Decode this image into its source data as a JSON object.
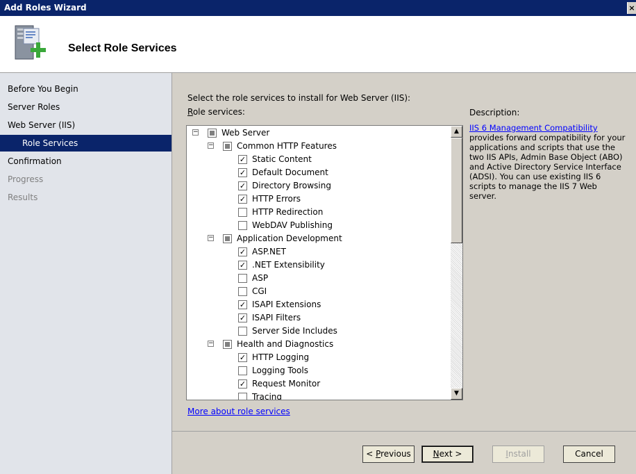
{
  "window": {
    "title": "Add Roles Wizard",
    "close_glyph": "×"
  },
  "header": {
    "title": "Select Role Services",
    "icon": "server-add-icon"
  },
  "nav": [
    {
      "label": "Before You Begin",
      "state": "normal"
    },
    {
      "label": "Server Roles",
      "state": "normal"
    },
    {
      "label": "Web Server (IIS)",
      "state": "normal"
    },
    {
      "label": "Role Services",
      "state": "active"
    },
    {
      "label": "Confirmation",
      "state": "normal"
    },
    {
      "label": "Progress",
      "state": "disabled"
    },
    {
      "label": "Results",
      "state": "disabled"
    }
  ],
  "content": {
    "prompt": "Select the role services to install for Web Server (IIS):",
    "role_services_label_prefix": "R",
    "role_services_label_rest": "ole services:",
    "description_label": "Description:",
    "description_link": "IIS 6 Management Compatibility",
    "description_text": "provides forward compatibility for your applications and scripts that use the two IIS APIs, Admin Base Object (ABO) and Active Directory Service Interface (ADSI). You can use existing IIS 6 scripts to manage the IIS 7 Web server.",
    "more_link": "More about role services"
  },
  "tree": [
    {
      "label": "Web Server",
      "level": 0,
      "state": "indeterminate",
      "expander": "−"
    },
    {
      "label": "Common HTTP Features",
      "level": 1,
      "state": "indeterminate",
      "expander": "−"
    },
    {
      "label": "Static Content",
      "level": 2,
      "state": "checked"
    },
    {
      "label": "Default Document",
      "level": 2,
      "state": "checked"
    },
    {
      "label": "Directory Browsing",
      "level": 2,
      "state": "checked"
    },
    {
      "label": "HTTP Errors",
      "level": 2,
      "state": "checked"
    },
    {
      "label": "HTTP Redirection",
      "level": 2,
      "state": "unchecked"
    },
    {
      "label": "WebDAV Publishing",
      "level": 2,
      "state": "unchecked"
    },
    {
      "label": "Application Development",
      "level": 1,
      "state": "indeterminate",
      "expander": "−"
    },
    {
      "label": "ASP.NET",
      "level": 2,
      "state": "checked"
    },
    {
      "label": ".NET Extensibility",
      "level": 2,
      "state": "checked"
    },
    {
      "label": "ASP",
      "level": 2,
      "state": "unchecked"
    },
    {
      "label": "CGI",
      "level": 2,
      "state": "unchecked"
    },
    {
      "label": "ISAPI Extensions",
      "level": 2,
      "state": "checked"
    },
    {
      "label": "ISAPI Filters",
      "level": 2,
      "state": "checked"
    },
    {
      "label": "Server Side Includes",
      "level": 2,
      "state": "unchecked"
    },
    {
      "label": "Health and Diagnostics",
      "level": 1,
      "state": "indeterminate",
      "expander": "−"
    },
    {
      "label": "HTTP Logging",
      "level": 2,
      "state": "checked"
    },
    {
      "label": "Logging Tools",
      "level": 2,
      "state": "unchecked"
    },
    {
      "label": "Request Monitor",
      "level": 2,
      "state": "checked"
    },
    {
      "label": "Tracing",
      "level": 2,
      "state": "unchecked"
    }
  ],
  "buttons": {
    "previous_prefix": "< ",
    "previous_key": "P",
    "previous_rest": "revious",
    "next_key": "N",
    "next_rest": "ext >",
    "install_key": "I",
    "install_rest": "nstall",
    "cancel": "Cancel"
  },
  "scroll": {
    "up_glyph": "▲",
    "down_glyph": "▼"
  },
  "check_glyph": "✓",
  "colors": {
    "titlebar": "#0a246a",
    "nav_bg": "#e1e4ea",
    "link": "#0000ff"
  }
}
